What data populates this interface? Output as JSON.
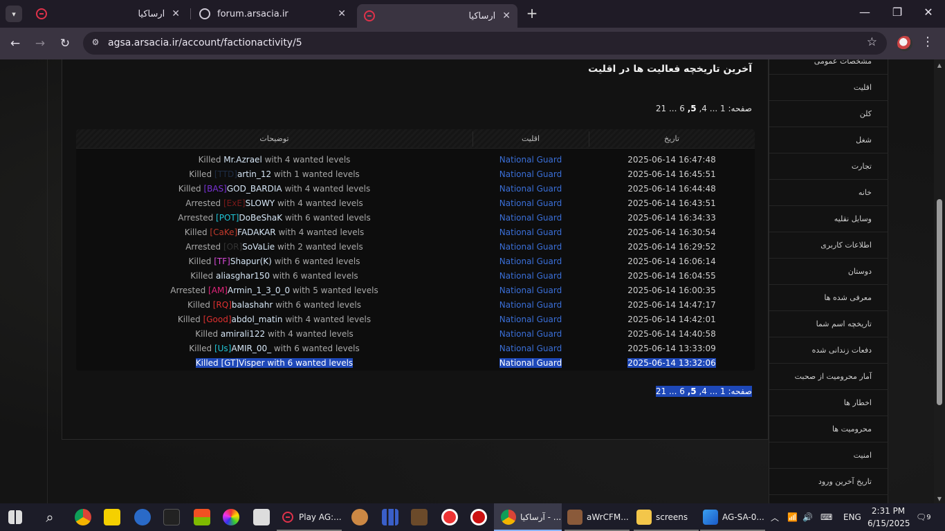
{
  "browser": {
    "tabs": [
      {
        "title": "آرساکیا",
        "favicon": "arsacia-icon",
        "active": false
      },
      {
        "title": "forum.arsacia.ir",
        "favicon": "globe-icon",
        "active": false
      },
      {
        "title": "آرساکیا",
        "favicon": "arsacia-icon",
        "active": true
      }
    ],
    "url": "agsa.arsacia.ir/account/factionactivity/5"
  },
  "page": {
    "heading": "آخرین تاریخچه فعالیت ها در اقلیت",
    "pager": {
      "label": "صفحه:",
      "pages": [
        "1",
        "...",
        "4,",
        "5,",
        "6",
        "...",
        "21"
      ],
      "current": "5,"
    },
    "table": {
      "headers": {
        "desc": "توضیحات",
        "faction": "اقلیت",
        "date": "تاریخ"
      },
      "rows": [
        {
          "action": "Killed",
          "tag": "",
          "name": "Mr.Azrael",
          "rest": "with 4 wanted levels",
          "faction": "National Guard",
          "date": "2025-06-14 16:47:48"
        },
        {
          "action": "Killed",
          "tag": "[TTD]",
          "name": "artin_12",
          "rest": "with 1 wanted levels",
          "faction": "National Guard",
          "date": "2025-06-14 16:45:51"
        },
        {
          "action": "Killed",
          "tag": "[BAS]",
          "name": "GOD_BARDIA",
          "rest": "with 4 wanted levels",
          "faction": "National Guard",
          "date": "2025-06-14 16:44:48"
        },
        {
          "action": "Arrested",
          "tag": "[ExE]",
          "name": "SLOWY",
          "rest": "with 4 wanted levels",
          "faction": "National Guard",
          "date": "2025-06-14 16:43:51"
        },
        {
          "action": "Arrested",
          "tag": "[POT]",
          "name": "DoBeShaK",
          "rest": "with 6 wanted levels",
          "faction": "National Guard",
          "date": "2025-06-14 16:34:33"
        },
        {
          "action": "Killed",
          "tag": "[CaKe]",
          "name": "FADAKAR",
          "rest": "with 4 wanted levels",
          "faction": "National Guard",
          "date": "2025-06-14 16:30:54"
        },
        {
          "action": "Arrested",
          "tag": "[OR]",
          "name": "SoVaLie",
          "rest": "with 2 wanted levels",
          "faction": "National Guard",
          "date": "2025-06-14 16:29:52"
        },
        {
          "action": "Killed",
          "tag": "[TF]",
          "name": "Shapur(K)",
          "rest": "with 6 wanted levels",
          "faction": "National Guard",
          "date": "2025-06-14 16:06:14"
        },
        {
          "action": "Killed",
          "tag": "",
          "name": "aliasghar150",
          "rest": "with 6 wanted levels",
          "faction": "National Guard",
          "date": "2025-06-14 16:04:55"
        },
        {
          "action": "Arrested",
          "tag": "[AM]",
          "name": "Armin_1_3_0_0",
          "rest": "with 5 wanted levels",
          "faction": "National Guard",
          "date": "2025-06-14 16:00:35"
        },
        {
          "action": "Killed",
          "tag": "[RQ]",
          "name": "balashahr",
          "rest": "with 6 wanted levels",
          "faction": "National Guard",
          "date": "2025-06-14 14:47:17"
        },
        {
          "action": "Killed",
          "tag": "[Good]",
          "name": "abdol_matin",
          "rest": "with 4 wanted levels",
          "faction": "National Guard",
          "date": "2025-06-14 14:42:01"
        },
        {
          "action": "Killed",
          "tag": "",
          "name": "amirali122",
          "rest": "with 4 wanted levels",
          "faction": "National Guard",
          "date": "2025-06-14 14:40:58"
        },
        {
          "action": "Killed",
          "tag": "[Us]",
          "name": "AMIR_00_",
          "rest": "with 6 wanted levels",
          "faction": "National Guard",
          "date": "2025-06-14 13:33:09"
        },
        {
          "action": "Killed",
          "tag": "[GT]",
          "name": "Visper",
          "rest": "with 6 wanted levels",
          "faction": "National Guard",
          "date": "2025-06-14 13:32:06"
        }
      ]
    },
    "sidebar": [
      "مشخصات عمومی",
      "اقلیت",
      "کلن",
      "شغل",
      "تجارت",
      "خانه",
      "وسایل نقلیه",
      "اطلاعات کاربری",
      "دوستان",
      "معرفی شده ها",
      "تاریخچه اسم شما",
      "دفعات زندانی شده",
      "آمار محرومیت از صحبت",
      "اخطار ها",
      "محرومیت ها",
      "امنیت",
      "تاریخ آخرین ورود"
    ]
  },
  "taskbar": {
    "apps": [
      {
        "label": "Play AG:...",
        "icon": "arsacia-icon"
      },
      {
        "label": "آرساکیا - ...",
        "icon": "chrome-icon"
      },
      {
        "label": "aWrCFM...",
        "icon": "image-app-icon"
      },
      {
        "label": "screens",
        "icon": "folder-icon"
      },
      {
        "label": "AG-SA-0...",
        "icon": "photos-icon"
      }
    ],
    "language": "ENG",
    "time": "2:31 PM",
    "date": "6/15/2025",
    "notifications": "9"
  }
}
